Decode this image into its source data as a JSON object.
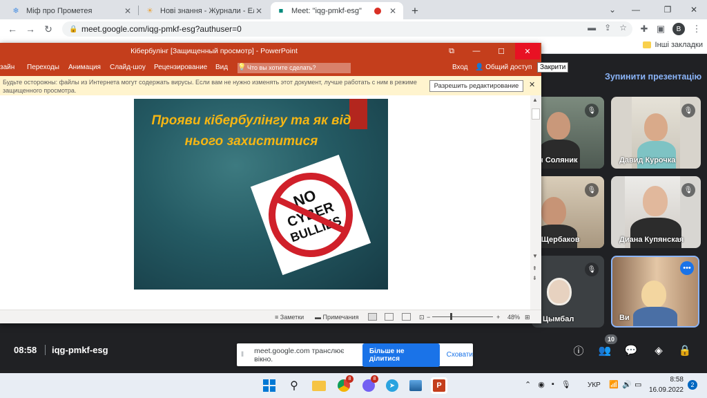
{
  "browser": {
    "tabs": [
      {
        "label": "Міф про Прометея",
        "icon": "snowflake-icon",
        "icon_glyph": "❄"
      },
      {
        "label": "Нові знання - Журнали - Електр",
        "icon": "sun-icon",
        "icon_glyph": "☀"
      },
      {
        "label": "Meet: \"iqg-pmkf-esg\"",
        "icon": "meet-icon",
        "icon_glyph": "■"
      }
    ],
    "new_tab": "+",
    "url": "meet.google.com/iqg-pmkf-esg?authuser=0",
    "profile_initial": "B",
    "other_bookmarks": "Інші закладки"
  },
  "powerpoint": {
    "title": "Кібербулінг [Защищенный просмотр] - PowerPoint",
    "ribbon_tabs": [
      "зайн",
      "Переходы",
      "Анимация",
      "Слайд-шоу",
      "Рецензирование",
      "Вид"
    ],
    "tell_me": "Что вы хотите сделать?",
    "sign_in": "Вход",
    "share": "Общий доступ",
    "close_tooltip": "Закрити",
    "protected_msg": "Будьте осторожны: файлы из Интернета могут содержать вирусы. Если вам не нужно изменять этот документ, лучше работать с ним в режиме защищенного просмотра.",
    "enable_editing": "Разрешить редактирование",
    "slide": {
      "title_line1": "Прояви кібербулінгу та як від",
      "title_line2": "нього захиститися",
      "sign_line1": "NO",
      "sign_line2": "CYBER",
      "sign_line3": "BULLIES"
    },
    "status": {
      "notes": "Заметки",
      "comments": "Примечания",
      "zoom": "48%"
    }
  },
  "meet": {
    "stop_presenting": "Зупинити презентацію",
    "time": "08:58",
    "code": "iqg-pmkf-esg",
    "people_count": "10",
    "participants": [
      {
        "name": "ан Соляник"
      },
      {
        "name": "Давид Курочка"
      },
      {
        "name": "р Щербаков"
      },
      {
        "name": "Диана Купянская"
      },
      {
        "name": "Цымбал"
      },
      {
        "name": "Ви"
      }
    ],
    "share_bar": {
      "message": "meet.google.com транслює вікно.",
      "stop": "Більше не ділитися",
      "hide": "Сховати"
    }
  },
  "taskbar": {
    "apps": [
      {
        "name": "windows-start-icon"
      },
      {
        "name": "search-icon"
      },
      {
        "name": "file-explorer-icon"
      },
      {
        "name": "chrome-icon",
        "badge": "8"
      },
      {
        "name": "viber-icon",
        "badge": "8"
      },
      {
        "name": "telegram-icon"
      },
      {
        "name": "photos-icon"
      },
      {
        "name": "powerpoint-icon"
      }
    ],
    "language": "УКР",
    "time": "8:58",
    "date": "16.09.2022",
    "notifications": "2"
  }
}
